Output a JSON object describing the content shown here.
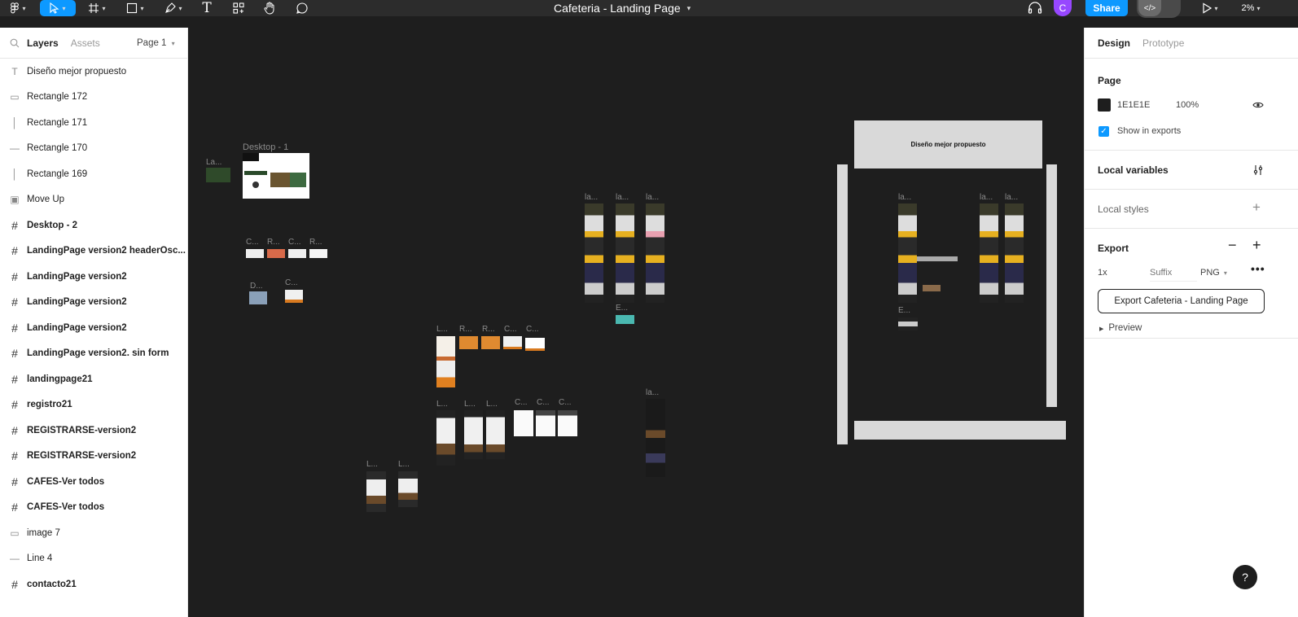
{
  "topbar": {
    "file_title": "Cafeteria - Landing Page",
    "share_label": "Share",
    "avatar_initial": "C",
    "zoom_label": "2%",
    "dev_mode_glyph": "</>"
  },
  "left_panel": {
    "tab_layers": "Layers",
    "tab_assets": "Assets",
    "page_selector": "Page 1",
    "layers": [
      {
        "name": "Diseño mejor propuesto",
        "icon": "text-icon",
        "glyph": "T",
        "kind": "text"
      },
      {
        "name": "Rectangle 172",
        "icon": "rectangle-icon",
        "glyph": "▭",
        "kind": "shape"
      },
      {
        "name": "Rectangle 171",
        "icon": "vertical-line-icon",
        "glyph": "│",
        "kind": "shape"
      },
      {
        "name": "Rectangle 170",
        "icon": "horizontal-line-icon",
        "glyph": "—",
        "kind": "shape"
      },
      {
        "name": "Rectangle 169",
        "icon": "vertical-line-icon",
        "glyph": "│",
        "kind": "shape"
      },
      {
        "name": "Move Up",
        "icon": "image-icon",
        "glyph": "▣",
        "kind": "image"
      },
      {
        "name": "Desktop - 2",
        "icon": "frame-icon",
        "glyph": "#",
        "kind": "frame"
      },
      {
        "name": "LandingPage version2 headerOsc...",
        "icon": "frame-icon",
        "glyph": "#",
        "kind": "frame"
      },
      {
        "name": "LandingPage version2",
        "icon": "frame-icon",
        "glyph": "#",
        "kind": "frame"
      },
      {
        "name": "LandingPage version2",
        "icon": "frame-icon",
        "glyph": "#",
        "kind": "frame"
      },
      {
        "name": "LandingPage version2",
        "icon": "frame-icon",
        "glyph": "#",
        "kind": "frame"
      },
      {
        "name": "LandingPage version2. sin form",
        "icon": "frame-icon",
        "glyph": "#",
        "kind": "frame"
      },
      {
        "name": "landingpage21",
        "icon": "frame-icon",
        "glyph": "#",
        "kind": "frame"
      },
      {
        "name": "registro21",
        "icon": "frame-icon",
        "glyph": "#",
        "kind": "frame"
      },
      {
        "name": "REGISTRARSE-version2",
        "icon": "frame-icon",
        "glyph": "#",
        "kind": "frame"
      },
      {
        "name": "REGISTRARSE-version2",
        "icon": "frame-icon",
        "glyph": "#",
        "kind": "frame"
      },
      {
        "name": "CAFES-Ver todos",
        "icon": "frame-icon",
        "glyph": "#",
        "kind": "frame"
      },
      {
        "name": "CAFES-Ver todos",
        "icon": "frame-icon",
        "glyph": "#",
        "kind": "frame"
      },
      {
        "name": "image 7",
        "icon": "rectangle-icon",
        "glyph": "▭",
        "kind": "shape"
      },
      {
        "name": "Line 4",
        "icon": "line-icon",
        "glyph": "—",
        "kind": "shape"
      },
      {
        "name": "contacto21",
        "icon": "frame-icon",
        "glyph": "#",
        "kind": "frame"
      }
    ]
  },
  "canvas": {
    "labels": {
      "desktop1": "Desktop - 1",
      "la": "La...",
      "c1": "C...",
      "r1": "R...",
      "c2": "C...",
      "r2": "R...",
      "d1": "D...",
      "c3": "C...",
      "la_a": "la...",
      "la_b": "la...",
      "la_c": "la...",
      "e1": "E...",
      "l1": "L...",
      "r3": "R...",
      "r4": "R...",
      "c4": "C...",
      "c5": "C...",
      "l2": "L...",
      "l3": "L...",
      "l4": "L...",
      "c6": "C...",
      "c7": "C...",
      "c8": "C...",
      "la_d": "la...",
      "l5": "L...",
      "l6": "L...",
      "group_title": "Diseño mejor propuesto",
      "g_la1": "la...",
      "g_la2": "la...",
      "g_la3": "la...",
      "g_e": "E..."
    }
  },
  "right_panel": {
    "tab_design": "Design",
    "tab_prototype": "Prototype",
    "page_title": "Page",
    "page_color_hex": "1E1E1E",
    "page_opacity": "100%",
    "show_in_exports": "Show in exports",
    "local_variables": "Local variables",
    "local_styles": "Local styles",
    "export_title": "Export",
    "export_scale": "1x",
    "export_suffix_placeholder": "Suffix",
    "export_format": "PNG",
    "export_button": "Export Cafeteria - Landing Page",
    "preview": "Preview",
    "help": "?"
  },
  "colors": {
    "accent": "#0d99ff",
    "canvas_bg": "#1e1e1e",
    "avatar": "#9747ff",
    "topbar_bg": "#2c2c2c"
  }
}
